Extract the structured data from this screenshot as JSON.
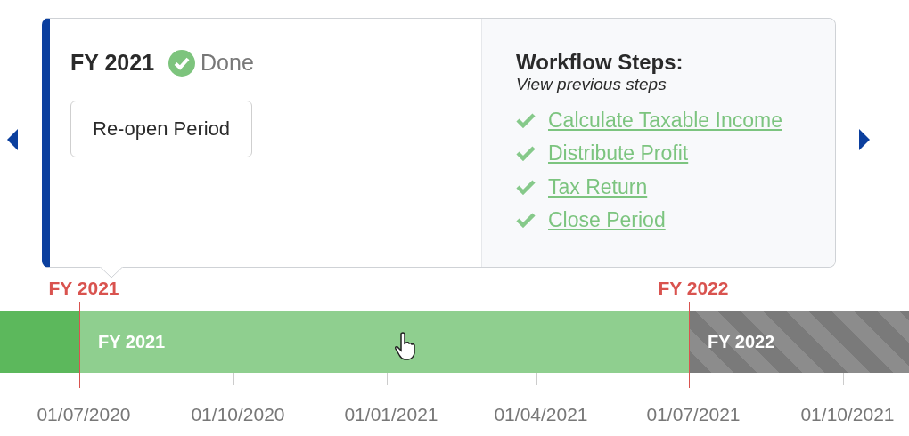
{
  "nav": {
    "previous": {
      "disabled": false
    },
    "next": {
      "disabled": false
    }
  },
  "period_card": {
    "title": "FY 2021",
    "status": {
      "label": "Done",
      "done": true
    },
    "button": "Re-open Period",
    "workflow": {
      "title": "Workflow Steps:",
      "subtitle": "View previous steps",
      "steps": [
        {
          "label": "Calculate Taxable Income",
          "done": true
        },
        {
          "label": "Distribute Profit",
          "done": true
        },
        {
          "label": "Tax Return",
          "done": true
        },
        {
          "label": "Close Period",
          "done": true
        }
      ]
    }
  },
  "timeline": {
    "markers": [
      "FY 2021",
      "FY 2022"
    ],
    "segments": [
      {
        "kind": "closed"
      },
      {
        "kind": "current",
        "label": "FY 2021"
      },
      {
        "kind": "future",
        "label": "FY 2022"
      }
    ],
    "dates": [
      "01/07/2020",
      "01/10/2020",
      "01/01/2021",
      "01/04/2021",
      "01/07/2021",
      "01/10/2021"
    ]
  }
}
